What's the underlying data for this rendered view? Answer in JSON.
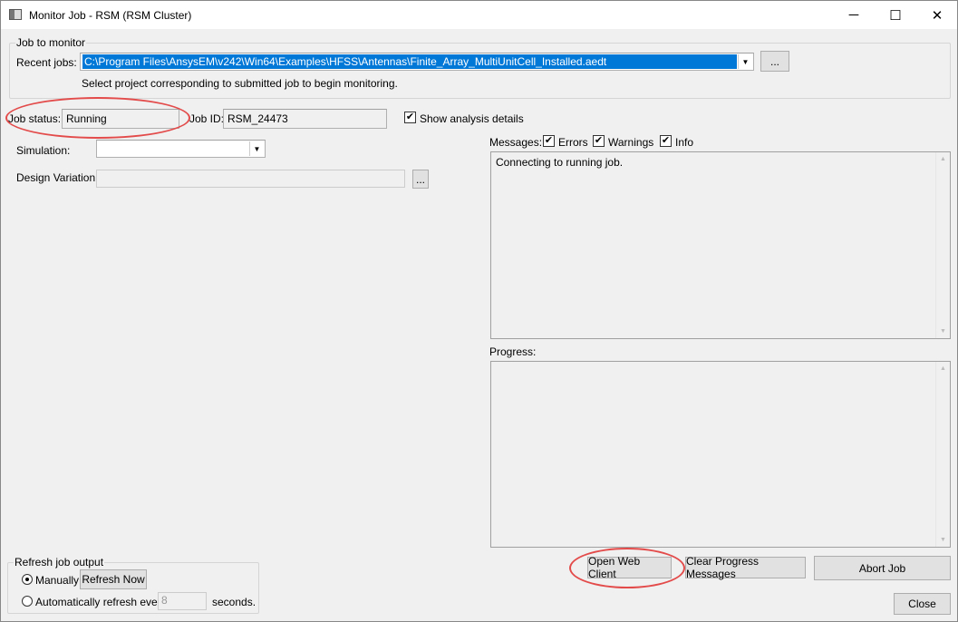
{
  "window": {
    "title": "Monitor Job - RSM (RSM Cluster)",
    "minimize": "─",
    "maximize": "☐",
    "close": "✕"
  },
  "job_to_monitor": {
    "legend": "Job to monitor",
    "recent_jobs_label": "Recent jobs:",
    "recent_jobs_value": "C:\\Program Files\\AnsysEM\\v242\\Win64\\Examples\\HFSS\\Antennas\\Finite_Array_MultiUnitCell_Installed.aedt",
    "browse": "...",
    "hint": "Select project corresponding to submitted job to begin monitoring."
  },
  "status": {
    "job_status_label": "Job status:",
    "job_status_value": "Running",
    "job_id_label": "Job ID:",
    "job_id_value": "RSM_24473",
    "show_details_label": "Show analysis details",
    "show_details_checked": true
  },
  "simulation": {
    "label": "Simulation:",
    "value": ""
  },
  "design_variation": {
    "label": "Design Variation:",
    "value": "",
    "browse": "..."
  },
  "messages": {
    "label": "Messages:",
    "errors": "Errors",
    "warnings": "Warnings",
    "info": "Info",
    "text": "Connecting to running job."
  },
  "progress": {
    "label": "Progress:"
  },
  "refresh": {
    "legend": "Refresh job output",
    "manually": "Manually",
    "refresh_now": "Refresh Now",
    "auto": "Automatically refresh every",
    "interval": "8",
    "seconds": "seconds."
  },
  "buttons": {
    "open_web_client": "Open Web Client",
    "clear_progress": "Clear Progress Messages",
    "abort": "Abort Job",
    "close": "Close"
  }
}
